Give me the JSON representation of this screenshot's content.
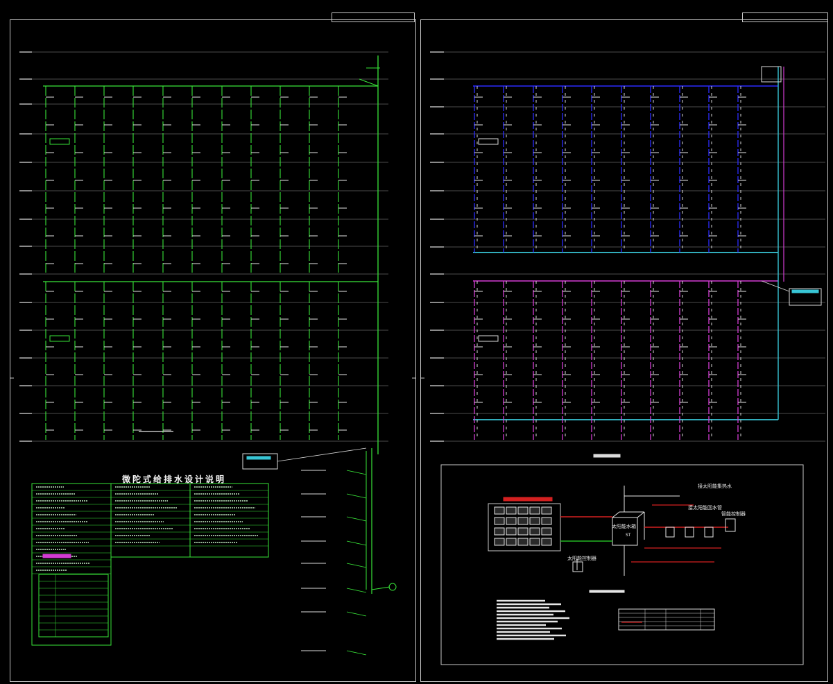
{
  "left_sheet": {
    "notes_title": "微陀式给排水设计说明"
  },
  "right_sheet": {
    "solar_labels": {
      "tank_label": "太阳能水箱",
      "tank_sub": "ST",
      "right_note_1": "接太阳能集热水",
      "right_note_2": "接太阳能回水管",
      "control_label": "智能控制器",
      "bottom_label": "太阳能控制器"
    }
  },
  "colors": {
    "frame": "#c8c8c8",
    "green": "#39e639",
    "blue": "#2b2bff",
    "cyan": "#38c6d6",
    "magenta": "#d43cd4",
    "red": "#d42020",
    "white": "#f0f0f0"
  }
}
